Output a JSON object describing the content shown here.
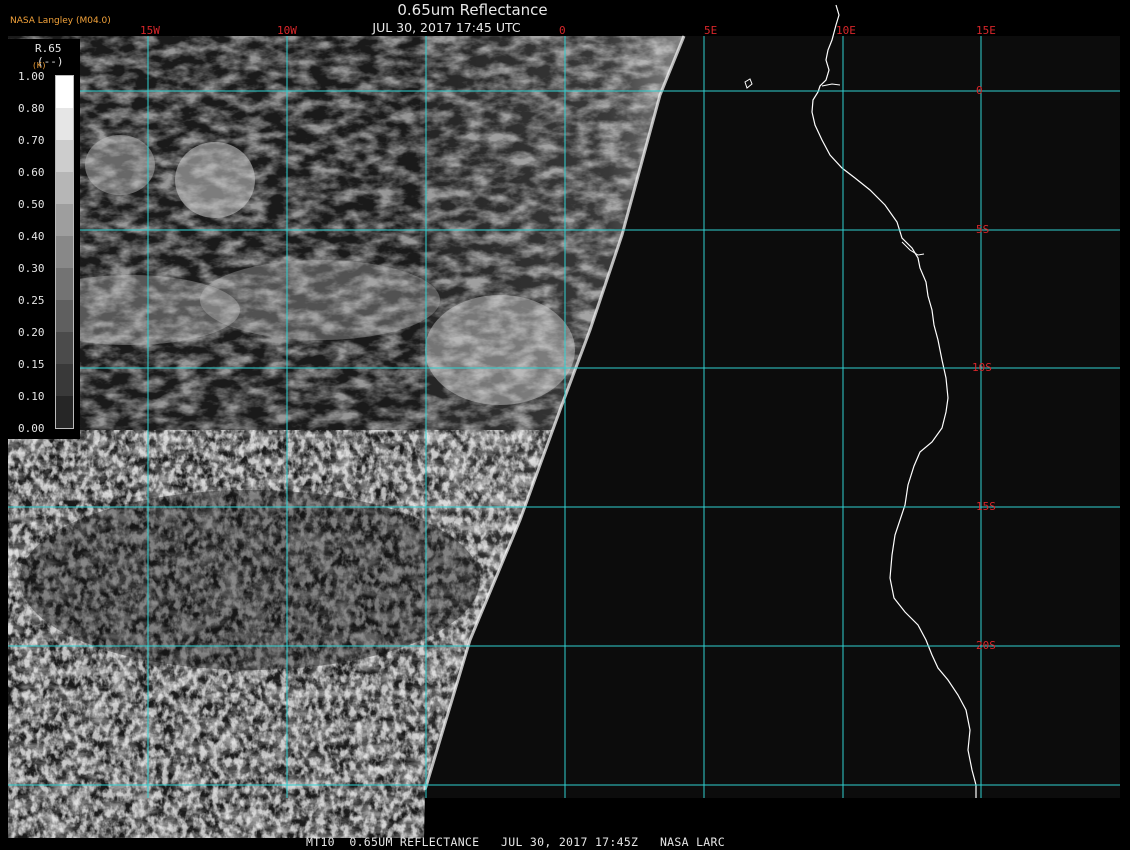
{
  "header": {
    "credit": "NASA Langley (M04.0)",
    "title": "0.65um Reflectance",
    "subtitle": "JUL 30, 2017 17:45 UTC"
  },
  "footer": {
    "text": "MT10  0.65UM REFLECTANCE   JUL 30, 2017 17:45Z   NASA LARC"
  },
  "map": {
    "lon_labels": [
      "15W",
      "10W",
      "0",
      "5E",
      "10E",
      "15E"
    ],
    "lat_labels": [
      "0",
      "5S",
      "10S",
      "15S",
      "20S"
    ],
    "grid_color": "#2fd0d0",
    "label_color": "#d8262a",
    "coastline_color": "#ffffff"
  },
  "legend": {
    "title": "R.65",
    "units": "(--)",
    "corner_mark": "(K)",
    "values": [
      "1.00",
      "0.80",
      "0.70",
      "0.60",
      "0.50",
      "0.40",
      "0.30",
      "0.25",
      "0.20",
      "0.15",
      "0.10",
      "0.00"
    ],
    "swatch_colors": [
      "#ffffff",
      "#e6e6e6",
      "#cdcdcd",
      "#b6b6b6",
      "#9e9e9e",
      "#888888",
      "#737373",
      "#5f5f5f",
      "#4b4b4b",
      "#393939",
      "#262626"
    ]
  }
}
